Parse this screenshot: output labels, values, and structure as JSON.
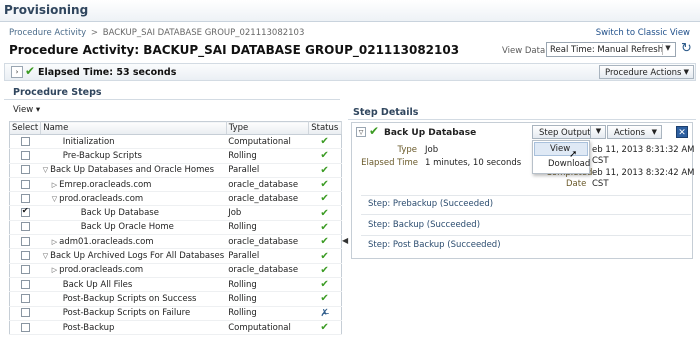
{
  "app": {
    "title": "Provisioning"
  },
  "breadcrumb": {
    "parent": "Procedure Activity",
    "separator": ">",
    "current": "BACKUP_SAI DATABASE GROUP_021113082103"
  },
  "header": {
    "switch_link": "Switch to Classic View",
    "page_title": "Procedure Activity: BACKUP_SAI DATABASE GROUP_021113082103",
    "view_data_label": "View Data",
    "view_data_value": "Real Time: Manual Refresh",
    "refresh_icon": "refresh-icon"
  },
  "elapsed": {
    "text": "Elapsed Time: 53 seconds",
    "procedure_actions": "Procedure Actions"
  },
  "steps": {
    "title": "Procedure Steps",
    "view_menu": "View ▾",
    "columns": {
      "select": "Select",
      "name": "Name",
      "type": "Type",
      "status": "Status"
    },
    "rows": [
      {
        "name": "Initialization",
        "indent": 1,
        "tri": "",
        "type": "Computational",
        "checked": false
      },
      {
        "name": "Pre-Backup Scripts",
        "indent": 1,
        "tri": "",
        "type": "Rolling",
        "checked": false
      },
      {
        "name": "Back Up Databases and Oracle Homes",
        "indent": 0,
        "tri": "▽",
        "type": "Parallel",
        "checked": false
      },
      {
        "name": "Emrep.oracleads.com",
        "indent": 1,
        "tri": "▷",
        "type": "oracle_database",
        "checked": false
      },
      {
        "name": "prod.oracleads.com",
        "indent": 1,
        "tri": "▽",
        "type": "oracle_database",
        "checked": false
      },
      {
        "name": "Back Up Database",
        "indent": 3,
        "tri": "",
        "type": "Job",
        "checked": true
      },
      {
        "name": "Back Up Oracle Home",
        "indent": 3,
        "tri": "",
        "type": "Rolling",
        "checked": false
      },
      {
        "name": "adm01.oracleads.com",
        "indent": 1,
        "tri": "▷",
        "type": "oracle_database",
        "checked": false
      },
      {
        "name": "Back Up Archived Logs For All Databases",
        "indent": 0,
        "tri": "▽",
        "type": "Parallel",
        "checked": false
      },
      {
        "name": "prod.oracleads.com",
        "indent": 1,
        "tri": "▷",
        "type": "oracle_database",
        "checked": false
      },
      {
        "name": "Back Up All Files",
        "indent": 1,
        "tri": "",
        "type": "Rolling",
        "checked": false
      },
      {
        "name": "Post-Backup Scripts on Success",
        "indent": 1,
        "tri": "",
        "type": "Rolling",
        "checked": false
      },
      {
        "name": "Post-Backup Scripts on Failure",
        "indent": 1,
        "tri": "",
        "type": "Rolling",
        "checked": false
      },
      {
        "name": "Post-Backup",
        "indent": 1,
        "tri": "",
        "type": "Computational",
        "checked": false
      }
    ],
    "status_icons": [
      "check-icon",
      "check-icon",
      "check-icon",
      "check-icon",
      "check-icon",
      "check-icon",
      "check-icon",
      "check-icon",
      "check-icon",
      "check-icon",
      "check-icon",
      "check-icon",
      "skipped-icon",
      "check-icon"
    ]
  },
  "details": {
    "title": "Step Details",
    "step_name": "Back Up Database",
    "step_output": "Step Output",
    "actions": "Actions",
    "type_label": "Type",
    "type_value": "Job",
    "elapsed_label": "Elapsed Time",
    "elapsed_value": "1 minutes, 10 seconds",
    "started_value_1": "eb 11, 2013 8:31:32 AM",
    "started_value_2": "CST",
    "completed_label": "Completed",
    "completed_value_1": "eb 11, 2013 8:32:42 AM",
    "date_label": "Date",
    "date_value": "CST",
    "menu": {
      "view": "View",
      "download": "Download"
    },
    "substeps": [
      "Step: Prebackup (Succeeded)",
      "Step: Backup (Succeeded)",
      "Step: Post Backup (Succeeded)"
    ]
  },
  "colors": {
    "success": "#3b9b23",
    "header_text": "#30465e",
    "link": "#1f4f8a"
  }
}
